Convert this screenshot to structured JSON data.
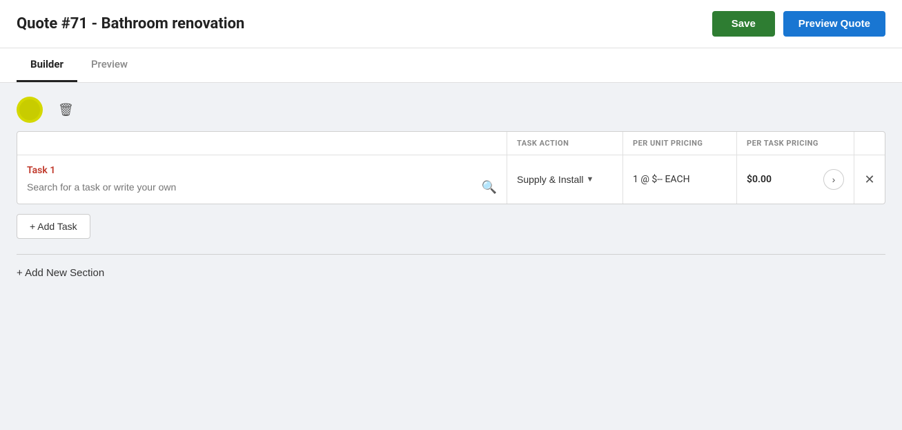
{
  "header": {
    "quote_number": "Quote #71",
    "separator": " - ",
    "title": "Bathroom renovation",
    "save_label": "Save",
    "preview_label": "Preview Quote"
  },
  "tabs": [
    {
      "id": "builder",
      "label": "Builder",
      "active": true
    },
    {
      "id": "preview",
      "label": "Preview",
      "active": false
    }
  ],
  "section": {
    "color": "#d4d800",
    "delete_icon": "🗑",
    "task": {
      "label": "Task 1",
      "search_placeholder": "Search for a task or write your own",
      "action": {
        "column_header": "TASK ACTION",
        "value": "Supply & Install",
        "has_dropdown": true
      },
      "per_unit": {
        "column_header": "PER UNIT PRICING",
        "value": "1 @ $-- EACH"
      },
      "per_task": {
        "column_header": "PER TASK PRICING",
        "value": "$0.00"
      }
    }
  },
  "add_task_label": "+ Add Task",
  "add_section_label": "+ Add New Section"
}
